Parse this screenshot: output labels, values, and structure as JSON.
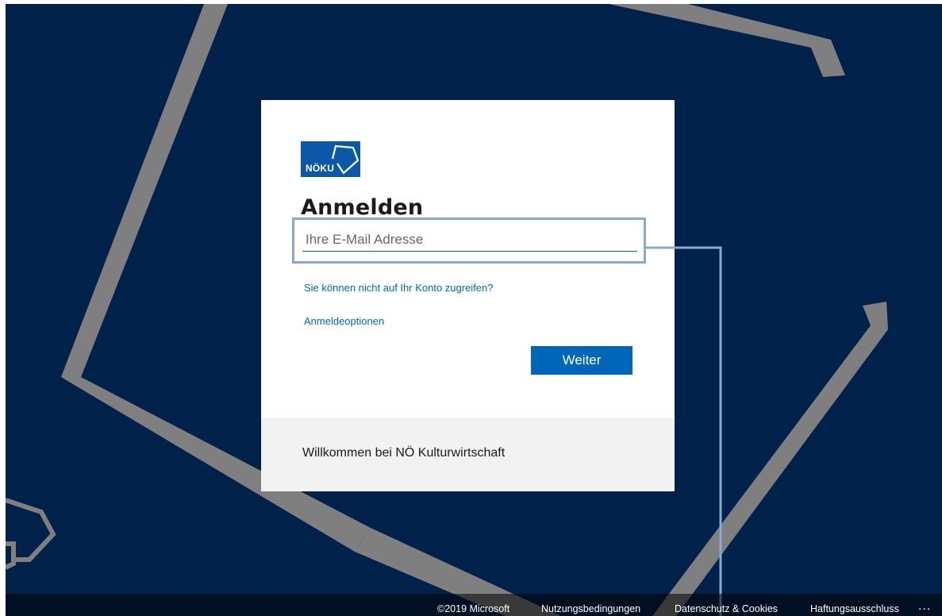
{
  "card": {
    "logo_text": "NÖKU",
    "title": "Anmelden",
    "email_placeholder": "Ihre E-Mail Adresse",
    "link_account": "Sie können nicht auf Ihr Konto zugreifen?",
    "link_options": "Anmeldeoptionen",
    "button_next": "Weiter",
    "welcome": "Willkommen bei NÖ Kulturwirtschaft"
  },
  "footer": {
    "copyright": "©2019 Microsoft",
    "terms": "Nutzungsbedingungen",
    "privacy": "Datenschutz & Cookies",
    "disclaimer": "Haftungsausschluss",
    "more": "..."
  },
  "colors": {
    "background": "#00224a",
    "accent": "#0067b8",
    "logo": "#0b58a8",
    "highlight": "#8aaad0"
  },
  "icons": [
    "noku-logo-icon",
    "more-icon"
  ]
}
